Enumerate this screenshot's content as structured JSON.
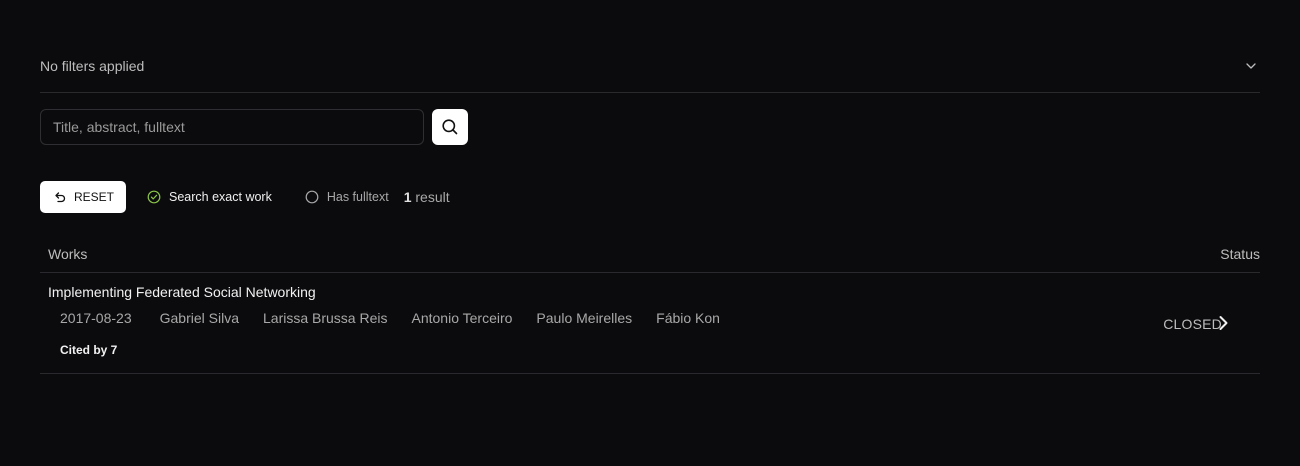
{
  "filters": {
    "summary": "No filters applied",
    "toggle_icon": "chevron-down-icon"
  },
  "search": {
    "placeholder": "Title, abstract, fulltext",
    "value": "",
    "button_icon": "search-icon"
  },
  "toolbar": {
    "reset_label": "RESET",
    "reset_icon": "undo-icon",
    "exact_label": "Search exact work",
    "exact_checked": true,
    "fulltext_label": "Has fulltext",
    "fulltext_checked": false,
    "result_number": "1",
    "result_word": "result"
  },
  "table": {
    "columns": {
      "works": "Works",
      "status": "Status"
    },
    "rows": [
      {
        "title": "Implementing Federated Social Networking",
        "date": "2017-08-23",
        "authors": [
          "Gabriel Silva",
          "Larissa Brussa Reis",
          "Antonio Terceiro",
          "Paulo Meirelles",
          "Fábio Kon"
        ],
        "cited": "Cited by 7",
        "status": "CLOSED"
      }
    ]
  },
  "colors": {
    "background": "#0b0b0d",
    "check_accent": "#8bc34a",
    "border": "#2a2a2e"
  }
}
